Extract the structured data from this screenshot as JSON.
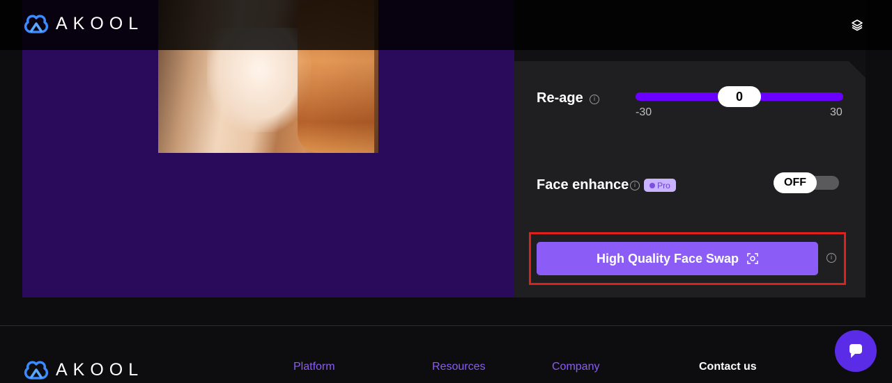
{
  "brand": {
    "name": "AKOOL"
  },
  "header": {
    "menu_icon": "layers-icon"
  },
  "settings": {
    "reage": {
      "label": "Re-age",
      "value": "0",
      "min": "-30",
      "max": "30",
      "info_icon": "info-icon"
    },
    "face_enhance": {
      "label": "Face enhance",
      "badge": "Pro",
      "toggle": "OFF",
      "info_icon": "info-icon"
    },
    "swap_button": {
      "label": "High Quality Face Swap",
      "icon": "face-scan-icon"
    }
  },
  "footer": {
    "links": [
      "Platform",
      "Resources",
      "Company"
    ],
    "contact": "Contact us"
  },
  "colors": {
    "accent": "#8b5cf6",
    "stage": "#2a0a5a",
    "slider": "#6a00ff",
    "highlight": "#e0201b"
  }
}
